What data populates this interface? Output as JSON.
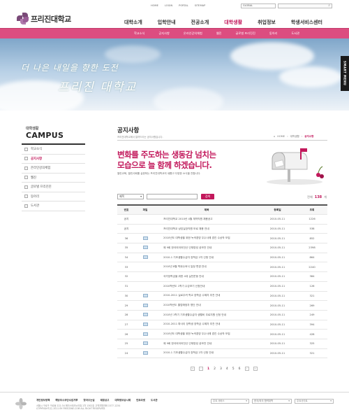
{
  "header": {
    "logo": "프리진대학교",
    "util": [
      "HOME",
      "LOGIN",
      "PORTAL",
      "SITEMAP"
    ],
    "global_select": "GLOBAL",
    "gnb": [
      "대학소개",
      "입학안내",
      "전공소개",
      "대학생활",
      "취업정보",
      "학생서비스센터"
    ],
    "gnb_active": 3,
    "sub": [
      "학교소식",
      "공지사항",
      "온라인강의체험",
      "웹진",
      "글로벌 프리진진",
      "동아리",
      "도서관"
    ]
  },
  "hero": {
    "slogan1": "더 나은 내일을 향한 도전",
    "slogan2": "프리진 대학교",
    "smart_menu": "SMART MENU"
  },
  "lnb": {
    "title_ko": "대학생활",
    "title_en": "CAMPUS",
    "items": [
      "학교소식",
      "공지사항",
      "온라인강의체험",
      "웹진",
      "글로벌 프리진진",
      "동아리",
      "도서관"
    ],
    "active": 1
  },
  "page": {
    "title": "공지사항",
    "desc": "프리진대학교에서 알려드리는 공지사항입니다.",
    "breadcrumb": [
      "HOME",
      "대학생활",
      "공지사항"
    ],
    "banner_line1": "변화를 주도하는 생동감 넘치는",
    "banner_line2": "모습으로 늘 함께 하겠습니다.",
    "banner_desc": "열린교육, 열린사회를 실현하는 프리진대학교의 새롭고 다양한 소식을 전합니다.",
    "search_select": "제목",
    "search_button": "검색",
    "count_label": "전체",
    "count_value": "138",
    "count_unit": "개"
  },
  "table": {
    "headers": [
      "번호",
      "파일",
      "제목",
      "등록일",
      "조회"
    ],
    "rows": [
      {
        "no": "공지",
        "file": false,
        "title": "프리진대학교 2010년 4월 계약직원 채용공고",
        "date": "2010-05-11",
        "views": "1226"
      },
      {
        "no": "공지",
        "file": false,
        "title": "프리진대학교 상담실장직원 모로 채용 안내",
        "date": "2010-05-11",
        "views": "538"
      },
      {
        "no": "36",
        "file": true,
        "title": "2010년도 대학생을 위한 녹색경영 우수사례 경진 수상작 모집",
        "date": "2010-05-11",
        "views": "852"
      },
      {
        "no": "35",
        "file": true,
        "title": "제 9회 한국외국어전산 인재양성 공모전 안내",
        "date": "2010-05-11",
        "views": "2398"
      },
      {
        "no": "34",
        "file": true,
        "title": "2010-1 기초생활수급자 장학금 2차 신청 안내",
        "date": "2010-05-11",
        "views": "864"
      },
      {
        "no": "33",
        "file": false,
        "title": "2010년 8월 학위수여식 일정 변경 안내",
        "date": "2010-05-11",
        "views": "2240"
      },
      {
        "no": "32",
        "file": false,
        "title": "국가장학금을 위한 4대 실천운동 안내",
        "date": "2010-05-11",
        "views": "384"
      },
      {
        "no": "31",
        "file": false,
        "title": "2010학년도 1학기 수강포기 신청안내",
        "date": "2010-05-11",
        "views": "126"
      },
      {
        "no": "30",
        "file": true,
        "title": "2010-2011 실로우커 학교 장학금 수혜자 추천 안내",
        "date": "2010-05-11",
        "views": "321"
      },
      {
        "no": "29",
        "file": true,
        "title": "2010학년도 졸업예정자 명단 안내",
        "date": "2010-05-11",
        "views": "269"
      },
      {
        "no": "28",
        "file": true,
        "title": "2010년 1학기 기초생활수급자 생활비 무료지원 신청 안내",
        "date": "2010-05-11",
        "views": "249"
      },
      {
        "no": "27",
        "file": true,
        "title": "2010-2011 파사이 장학생 장학금 수혜자 추천 안내",
        "date": "2010-05-11",
        "views": "394"
      },
      {
        "no": "26",
        "file": true,
        "title": "2010년도 대학생을 위한 녹색경영 우수사례 경진 수상작 모집",
        "date": "2010-05-11",
        "views": "428"
      },
      {
        "no": "25",
        "file": true,
        "title": "제 9회 한국외국어전산 인재양성 공모전 안내",
        "date": "2010-05-11",
        "views": "325"
      },
      {
        "no": "24",
        "file": true,
        "title": "2010-1 기초생활수급자 장학금 2차 신청 안내",
        "date": "2010-05-11",
        "views": "321"
      }
    ]
  },
  "pager": {
    "first": "«",
    "prev": "‹",
    "pages": [
      "1",
      "2",
      "3",
      "4",
      "5",
      "6"
    ],
    "current": "1",
    "next": "›",
    "last": "»"
  },
  "footer": {
    "links": [
      "개인정보정책",
      "해당주소무단수집거부",
      "찾아오는길",
      "채용공고",
      "대학정보공시제",
      "인트라넷",
      "도서관"
    ],
    "address": "서울시 구로구 구로동 222-34 에이스테크노타워 2차 1302호 고객지원전화 1577-1234",
    "copyright": "COPYRIGHT(C) 2011 BY FREEZINE.COM ALL RIGHT RESERVED.",
    "select1": "주요 서비스",
    "select2": "한국/외국 협력대학",
    "select3": "주요사이트"
  }
}
